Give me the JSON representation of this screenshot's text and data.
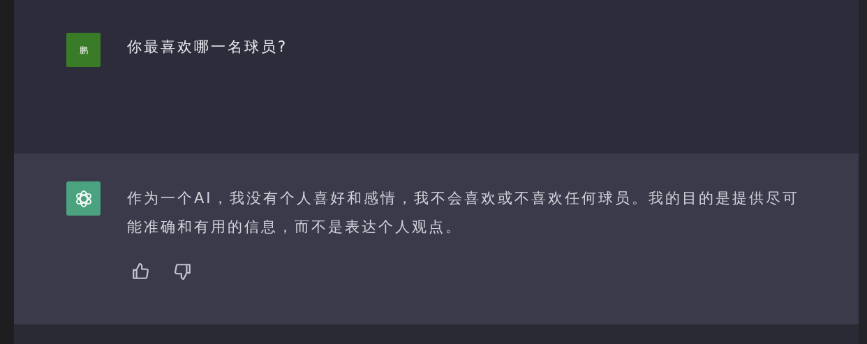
{
  "messages": [
    {
      "kind": "user",
      "avatar": "鹏",
      "text": "你最喜欢哪一名球员?"
    },
    {
      "kind": "assistant",
      "text": "作为一个AI，我没有个人喜好和感情，我不会喜欢或不喜欢任何球员。我的目的是提供尽可能准确和有用的信息，而不是表达个人观点。"
    }
  ]
}
